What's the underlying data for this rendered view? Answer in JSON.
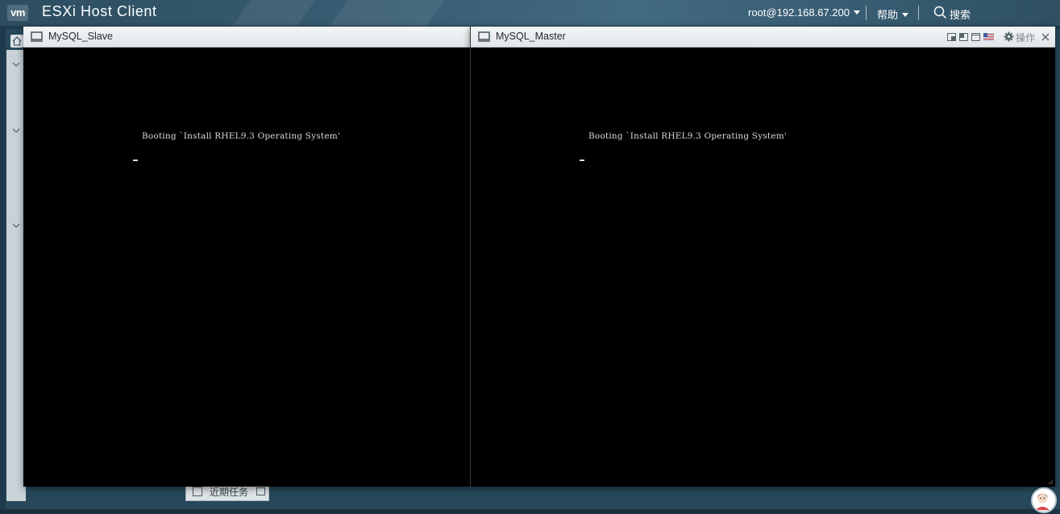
{
  "header": {
    "logo_text": "vm",
    "app_title": "ESXi Host Client",
    "user_menu": "root@192.168.67.200",
    "help_menu": "帮助",
    "search_label": "搜索"
  },
  "consoles": [
    {
      "title": "MySQL_Slave",
      "boot_line": "Booting `Install RHEL9.3 Operating System'"
    },
    {
      "title": "MySQL_Master",
      "boot_line": "Booting `Install RHEL9.3 Operating System'",
      "actions_label": "操作",
      "icons": [
        "restore-icon",
        "window-icon",
        "maximize-icon",
        "flag-icon",
        "gear-icon",
        "close-icon"
      ]
    }
  ],
  "taskbar": {
    "recent_tasks_label": "近期任务"
  },
  "colors": {
    "header_bg": "#385c71",
    "console_bg": "#000000",
    "titlebar_bg": "#e8ecee",
    "boot_text": "#d9d9d9"
  }
}
